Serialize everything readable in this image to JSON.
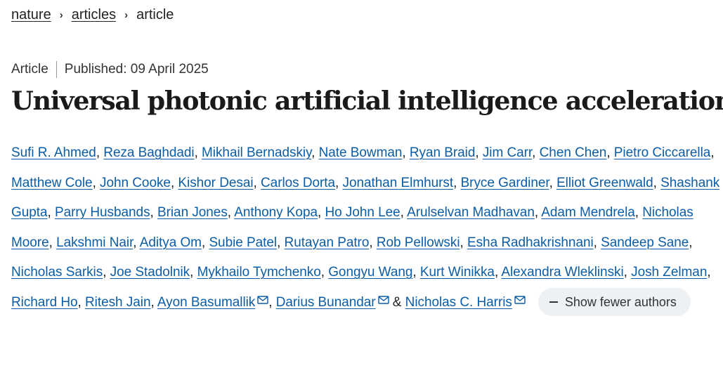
{
  "breadcrumb": {
    "items": [
      "nature",
      "articles"
    ],
    "current": "article",
    "separator": "›"
  },
  "meta": {
    "type": "Article",
    "published": "Published: 09 April 2025"
  },
  "article": {
    "title": "Universal photonic artificial intelligence acceleration"
  },
  "authors": [
    "Sufi R. Ahmed",
    "Reza Baghdadi",
    "Mikhail Bernadskiy",
    "Nate Bowman",
    "Ryan Braid",
    "Jim Carr",
    "Chen Chen",
    "Pietro Ciccarella",
    "Matthew Cole",
    "John Cooke",
    "Kishor Desai",
    "Carlos Dorta",
    "Jonathan Elmhurst",
    "Bryce Gardiner",
    "Elliot Greenwald",
    "Shashank Gupta",
    "Parry Husbands",
    "Brian Jones",
    "Anthony Kopa",
    "Ho John Lee",
    "Arulselvan Madhavan",
    "Adam Mendrela",
    "Nicholas Moore",
    "Lakshmi Nair",
    "Aditya Om",
    "Subie Patel",
    "Rutayan Patro",
    "Rob Pellowski",
    "Esha Radhakrishnani",
    "Sandeep Sane",
    "Nicholas Sarkis",
    "Joe Stadolnik",
    "Mykhailo Tymchenko",
    "Gongyu Wang",
    "Kurt Winikka",
    "Alexandra Wleklinski",
    "Josh Zelman",
    "Richard Ho",
    "Ritesh Jain",
    "Ayon Basumallik",
    "Darius Bunandar",
    "Nicholas C. Harris"
  ],
  "corresponding_authors": [
    "Ayon Basumallik",
    "Darius Bunandar",
    "Nicholas C. Harris"
  ],
  "author_conjunction": "&",
  "show_fewer_label": "Show fewer authors",
  "icons": {
    "separator": "chevron-right-icon",
    "email": "envelope-icon",
    "collapse": "minus-icon"
  },
  "colors": {
    "link": "#0c5da5",
    "pill_bg": "#eef1f4",
    "text": "#222222"
  }
}
